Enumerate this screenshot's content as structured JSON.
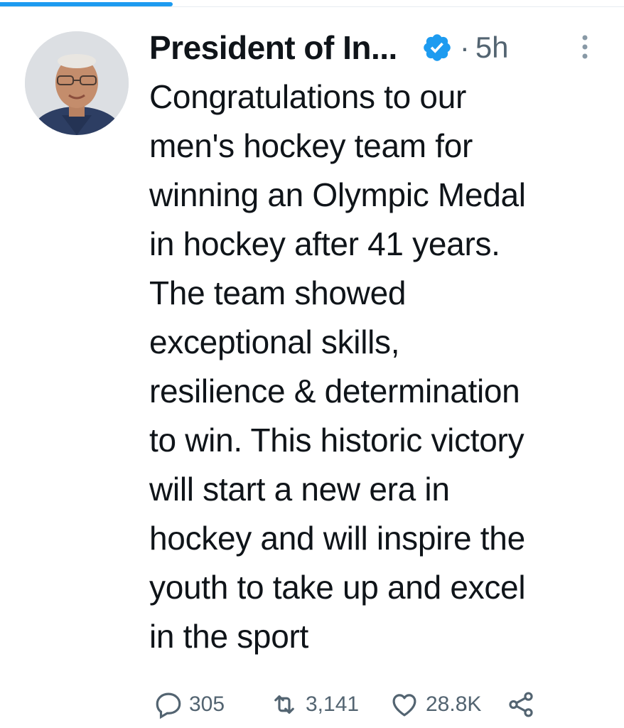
{
  "tweet": {
    "author_name": "President of In...",
    "separator": "·",
    "timestamp": "5h",
    "text": "Congratulations to our\nmen's hockey team for\nwinning an Olympic Medal\nin hockey after 41 years.\nThe team showed\nexceptional skills,\nresilience & determination\nto win. This historic victory\nwill start a new era in\nhockey and will inspire the\nyouth to take up and excel\nin the sport"
  },
  "actions": {
    "reply_count": "305",
    "retweet_count": "3,141",
    "like_count": "28.8K"
  },
  "icons": {
    "verified": "verified-badge-icon",
    "more": "more-vertical-icon",
    "reply": "reply-icon",
    "retweet": "retweet-icon",
    "like": "heart-icon",
    "share": "share-icon"
  },
  "colors": {
    "accent": "#1d9bf0",
    "text": "#0f1419",
    "muted": "#536471"
  }
}
